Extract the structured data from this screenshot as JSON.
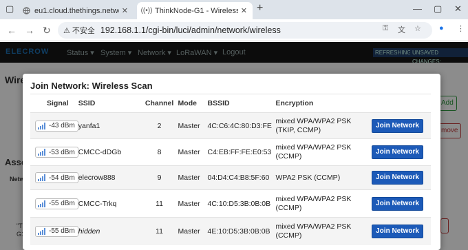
{
  "browser": {
    "tabs": [
      {
        "title": "eu1.cloud.thethings.network",
        "favicon": "globe-icon",
        "active": false
      },
      {
        "title": "ThinkNode-G1 - Wireless - Lu",
        "favicon": "wifi-icon",
        "active": true
      }
    ],
    "new_tab_label": "+",
    "security_label": "不安全",
    "url": "192.168.1.1/cgi-bin/luci/admin/network/wireless"
  },
  "luci": {
    "logo": "ELECROW",
    "menu": [
      "Status ▾",
      "System ▾",
      "Network ▾",
      "LoRaWAN ▾",
      "Logout"
    ],
    "badges": [
      "REFRESHING",
      "UNSAVED CHANGES:"
    ],
    "bg_heading": "Wire",
    "bg_assoc": "Asso",
    "bg_netw": "Netw",
    "bg_add": "Add",
    "bg_remove": "move",
    "bg_quote": "\"Th",
    "bg_g1": "G1"
  },
  "modal": {
    "title": "Join Network: Wireless Scan",
    "columns": [
      "Signal",
      "SSID",
      "Channel",
      "Mode",
      "BSSID",
      "Encryption"
    ],
    "rows": [
      {
        "signal": "-43 dBm",
        "ssid": "yanfa1",
        "channel": "2",
        "mode": "Master",
        "bssid": "4C:C6:4C:80:D3:FE",
        "enc1": "mixed WPA/WPA2 PSK",
        "enc2": "(TKIP, CCMP)",
        "action": "Join Network"
      },
      {
        "signal": "-53 dBm",
        "ssid": "CMCC-dDGb",
        "channel": "8",
        "mode": "Master",
        "bssid": "C4:EB:FF:FE:E0:53",
        "enc1": "mixed WPA/WPA2 PSK",
        "enc2": "(CCMP)",
        "action": "Join Network"
      },
      {
        "signal": "-54 dBm",
        "ssid": "elecrow888",
        "channel": "9",
        "mode": "Master",
        "bssid": "04:D4:C4:B8:5F:60",
        "enc1": "WPA2 PSK (CCMP)",
        "enc2": "",
        "action": "Join Network"
      },
      {
        "signal": "-55 dBm",
        "ssid": "CMCC-Trkq",
        "channel": "11",
        "mode": "Master",
        "bssid": "4C:10:D5:3B:0B:0B",
        "enc1": "mixed WPA/WPA2 PSK",
        "enc2": "(CCMP)",
        "action": "Join Network"
      },
      {
        "signal": "-55 dBm",
        "ssid": "hidden",
        "channel": "11",
        "mode": "Master",
        "bssid": "4E:10:D5:3B:0B:0B",
        "enc1": "mixed WPA/WPA2 PSK",
        "enc2": "(CCMP)",
        "action": "Join Network",
        "ssid_hidden": true
      }
    ]
  },
  "colors": {
    "join_button": "#1c5ab8",
    "luci_header": "#171717",
    "add_button": "#2e9c3e",
    "remove_button": "#c33b3b"
  }
}
